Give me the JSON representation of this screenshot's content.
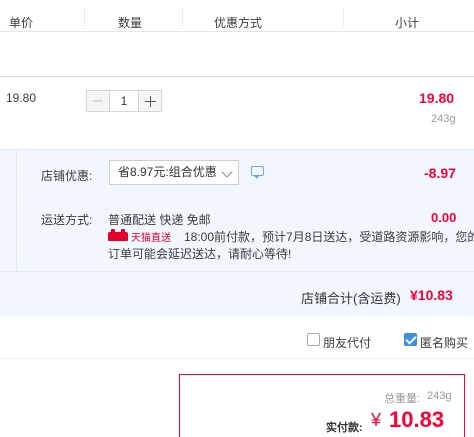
{
  "header": {
    "col_price": "单价",
    "col_qty": "数量",
    "col_promo": "优惠方式",
    "col_subtotal": "小计"
  },
  "item": {
    "unit_price": "19.80",
    "quantity": "1",
    "subtotal": "19.80",
    "weight": "243g"
  },
  "shop": {
    "discount_label": "店铺优惠:",
    "discount_select": "省8.97元:组合优惠",
    "discount_amount": "-8.97",
    "shipping_label": "运送方式:",
    "shipping_method": "普通配送 快递 免邮",
    "shipping_fee": "0.00",
    "tmall_badge": "天猫直送",
    "notice_line1": "18:00前付款，预计7月8日送达，受道路资源影响，您的",
    "notice_line2": "订单可能会延迟送达，请耐心等待!",
    "total_label": "店铺合计(含运费)",
    "total_amount": "¥10.83"
  },
  "options": {
    "friend_pay": "朋友代付",
    "anonymous": "匿名购买",
    "friend_pay_checked": false,
    "anonymous_checked": true
  },
  "summary": {
    "weight_label": "总重量:",
    "weight_value": "243g",
    "pay_label": "实付款:",
    "currency": "¥",
    "pay_amount": "10.83"
  },
  "colors": {
    "accent_red": "#ff0036",
    "panel_bg": "#f2f7ff",
    "check_blue": "#3d8ee8"
  }
}
